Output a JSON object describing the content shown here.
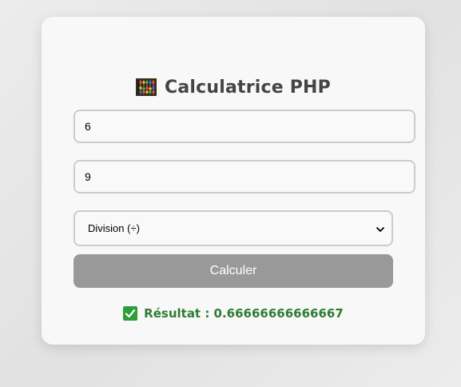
{
  "calculator": {
    "title": "Calculatrice PHP",
    "title_icon": "abacus-icon",
    "first_number": "6",
    "second_number": "9",
    "operation": {
      "selected": "Division (÷)"
    },
    "submit_label": "Calculer",
    "result": {
      "icon": "check-box-icon",
      "label": "Résultat : 0.66666666666667"
    }
  },
  "colors": {
    "card_background": "#f8f8f8",
    "button_background": "#999999",
    "result_text": "#2e7d32",
    "check_box": "#2e9e3a"
  }
}
